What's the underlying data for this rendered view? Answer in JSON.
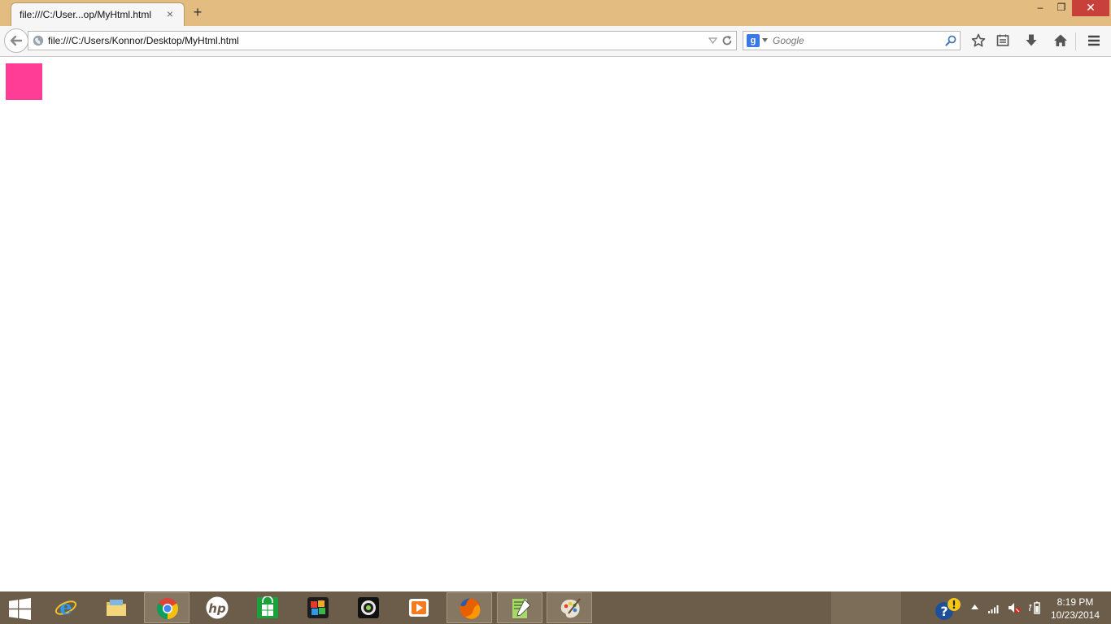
{
  "window": {
    "tab_title": "file:///C:/User...op/MyHtml.html",
    "tab_close_glyph": "×",
    "new_tab_glyph": "+",
    "minimize_glyph": "–",
    "maximize_glyph": "❐",
    "close_glyph": "✕"
  },
  "navbar": {
    "url": "file:///C:/Users/Konnor/Desktop/MyHtml.html",
    "search_placeholder": "Google",
    "search_engine_letter": "g",
    "icons": [
      "back-arrow-icon",
      "globe-icon",
      "dropmarker-icon",
      "reload-icon",
      "search-icon",
      "star-icon",
      "reading-list-icon",
      "download-icon",
      "home-icon",
      "menu-icon"
    ]
  },
  "content": {
    "box_color": "#ff3d97"
  },
  "taskbar": {
    "apps": [
      "start",
      "internet-explorer",
      "file-explorer",
      "chrome",
      "hp",
      "windows-store",
      "media-app",
      "camera-app",
      "video-app",
      "firefox",
      "notepad-plus-plus",
      "paint"
    ],
    "active_apps": [
      "chrome",
      "firefox",
      "notepad-plus-plus",
      "paint"
    ],
    "clock_time": "8:19 PM",
    "clock_date": "10/23/2014"
  },
  "colors": {
    "titlebar": "#e3bc82",
    "taskbar": "#6b5d49",
    "close_button": "#c7413a"
  }
}
